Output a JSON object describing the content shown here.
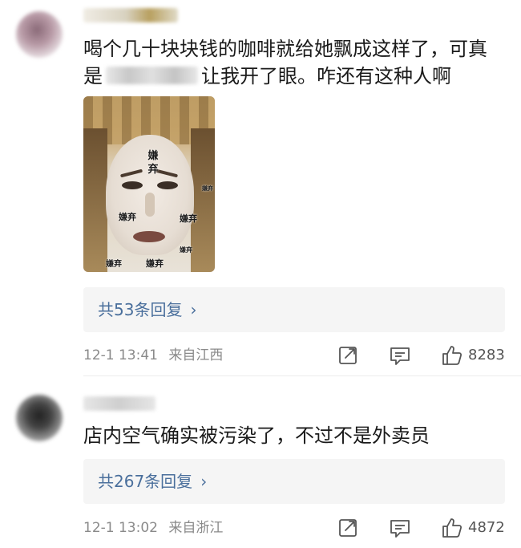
{
  "comments": [
    {
      "text_part1": "喝个几十块块钱的咖啡就给她飘成这样了，可真是",
      "text_part2": "让我开了眼。咋还有这种人啊",
      "meme": {
        "labels": [
          "嫌弃",
          "嫌弃",
          "嫌弃",
          "嫌弃",
          "嫌弃",
          "嫌弃",
          "嫌弃"
        ]
      },
      "replies_label": "共53条回复",
      "timestamp": "12-1 13:41",
      "location": "来自江西",
      "likes": "8283"
    },
    {
      "text": "店内空气确实被污染了，不过不是外卖员",
      "replies_label": "共267条回复",
      "timestamp": "12-1 13:02",
      "location": "来自浙江",
      "likes": "4872"
    }
  ],
  "icons": {
    "share": "share-icon",
    "comment": "comment-icon",
    "like": "thumbs-up-icon",
    "chevron": "chevron-right-icon"
  },
  "colors": {
    "link": "#4a6f9c",
    "meta": "#8a8a8a",
    "replies_bg": "#f5f5f5"
  }
}
